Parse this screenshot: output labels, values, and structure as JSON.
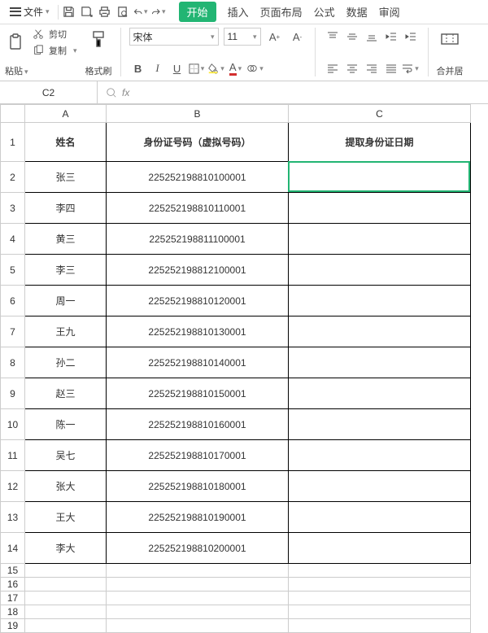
{
  "menubar": {
    "file": "文件",
    "tabs": [
      "开始",
      "插入",
      "页面布局",
      "公式",
      "数据",
      "审阅"
    ],
    "active_tab": "开始"
  },
  "ribbon": {
    "cut": "剪切",
    "paste": "粘贴",
    "copy": "复制",
    "format_painter": "格式刷",
    "font_name": "宋体",
    "font_size": "11",
    "merge": "合并居"
  },
  "namebox": {
    "cell": "C2"
  },
  "formula": {
    "fx": "fx",
    "value": ""
  },
  "columns": [
    "A",
    "B",
    "C"
  ],
  "headers": {
    "A": "姓名",
    "B": "身份证号码（虚拟号码）",
    "C": "提取身份证日期"
  },
  "rows": [
    {
      "n": 1
    },
    {
      "n": 2,
      "A": "张三",
      "B": "225252198810100001",
      "C": ""
    },
    {
      "n": 3,
      "A": "李四",
      "B": "225252198810110001",
      "C": ""
    },
    {
      "n": 4,
      "A": "黄三",
      "B": "225252198811100001",
      "C": ""
    },
    {
      "n": 5,
      "A": "李三",
      "B": "225252198812100001",
      "C": ""
    },
    {
      "n": 6,
      "A": "周一",
      "B": "225252198810120001",
      "C": ""
    },
    {
      "n": 7,
      "A": "王九",
      "B": "225252198810130001",
      "C": ""
    },
    {
      "n": 8,
      "A": "孙二",
      "B": "225252198810140001",
      "C": ""
    },
    {
      "n": 9,
      "A": "赵三",
      "B": "225252198810150001",
      "C": ""
    },
    {
      "n": 10,
      "A": "陈一",
      "B": "225252198810160001",
      "C": ""
    },
    {
      "n": 11,
      "A": "吴七",
      "B": "225252198810170001",
      "C": ""
    },
    {
      "n": 12,
      "A": "张大",
      "B": "225252198810180001",
      "C": ""
    },
    {
      "n": 13,
      "A": "王大",
      "B": "225252198810190001",
      "C": ""
    },
    {
      "n": 14,
      "A": "李大",
      "B": "225252198810200001",
      "C": ""
    },
    {
      "n": 15
    },
    {
      "n": 16
    },
    {
      "n": 17
    },
    {
      "n": 18
    },
    {
      "n": 19
    }
  ],
  "active": {
    "row": 2,
    "col": "C"
  }
}
